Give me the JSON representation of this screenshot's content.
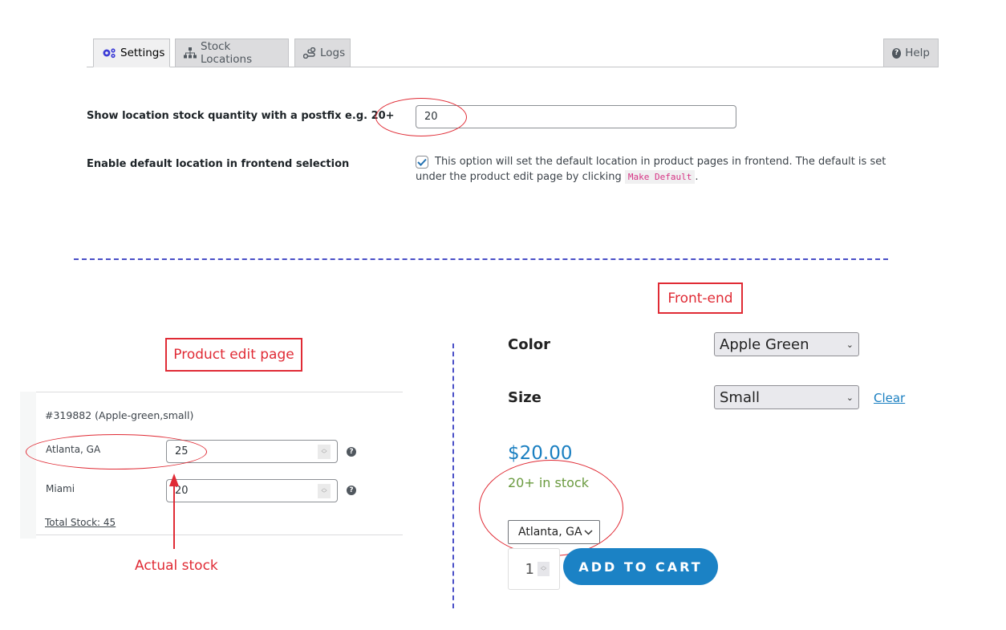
{
  "tabs": [
    {
      "label": "Settings",
      "icon": "gears-icon",
      "active": true
    },
    {
      "label": "Stock Locations",
      "icon": "sitemap-icon",
      "active": false
    },
    {
      "label": "Logs",
      "icon": "route-icon",
      "active": false
    }
  ],
  "help": {
    "label": "Help",
    "icon": "question-circle-icon"
  },
  "settings": {
    "postfix_label": "Show location stock quantity with a postfix e.g. 20+",
    "postfix_value": "20",
    "default_location_label": "Enable default location in frontend selection",
    "default_location_checked": true,
    "default_location_desc": "This option will set the default location in product pages in frontend. The default is set under the product edit page by clicking",
    "default_location_code": "Make Default",
    "default_location_desc_end": "."
  },
  "annotations": {
    "front_end": "Front-end",
    "product_edit_page": "Product edit page",
    "actual_stock": "Actual stock",
    "colors": {
      "annotation": "#e02b35",
      "divider": "#4a4fc7"
    }
  },
  "product_edit": {
    "variation_title": "#319882 (Apple-green,small)",
    "locations": [
      {
        "name": "Atlanta, GA",
        "stock": "25"
      },
      {
        "name": "Miami",
        "stock": "20"
      }
    ],
    "total_stock": "Total Stock: 45"
  },
  "frontend": {
    "color_label": "Color",
    "color_value": "Apple Green",
    "size_label": "Size",
    "size_value": "Small",
    "clear_label": "Clear",
    "price": "$20.00",
    "stock_status": "20+ in stock",
    "location_value": "Atlanta, GA",
    "quantity": "1",
    "add_to_cart": "ADD TO CART",
    "colors": {
      "price": "#1a7fc1",
      "stock": "#6a9a3f",
      "button": "#1b82c5"
    }
  }
}
